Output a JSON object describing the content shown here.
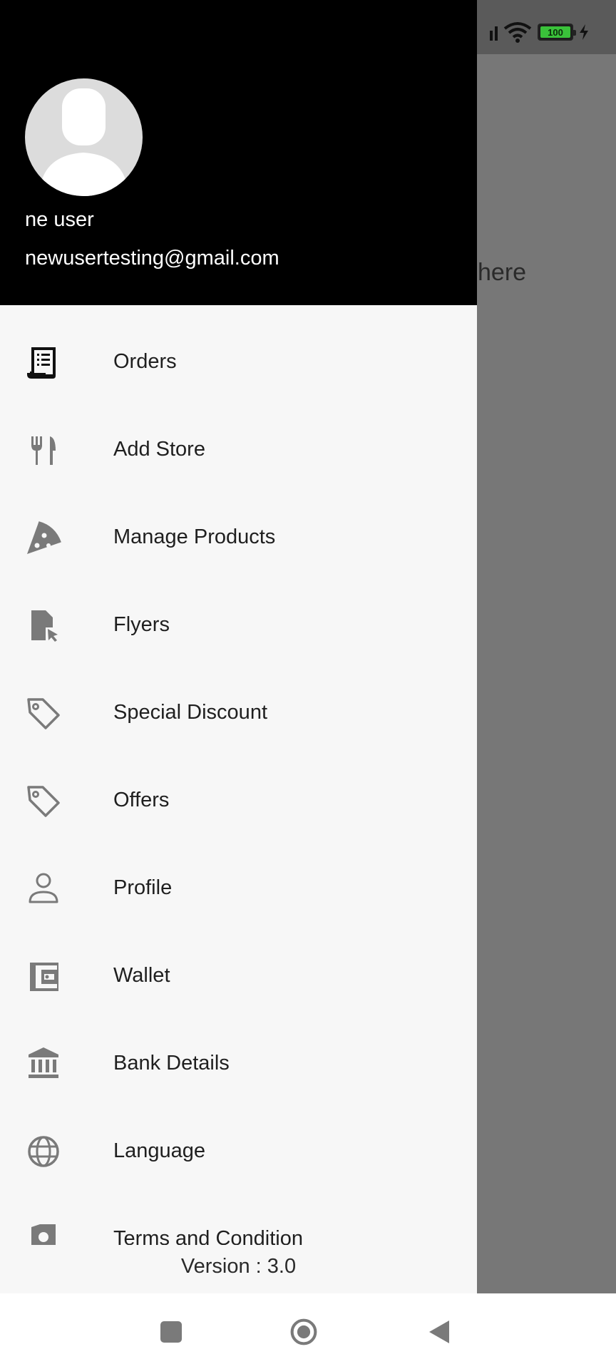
{
  "status_bar": {
    "battery_level": "100"
  },
  "background": {
    "partial_text": "here"
  },
  "drawer": {
    "header": {
      "user_name": "ne user",
      "user_email": "newusertesting@gmail.com"
    },
    "menu_items": [
      {
        "label": "Orders",
        "icon": "receipt-icon"
      },
      {
        "label": "Add Store",
        "icon": "restaurant-icon"
      },
      {
        "label": "Manage Products",
        "icon": "pizza-icon"
      },
      {
        "label": "Flyers",
        "icon": "file-pointer-icon"
      },
      {
        "label": "Special Discount",
        "icon": "tag-icon"
      },
      {
        "label": "Offers",
        "icon": "tag-icon"
      },
      {
        "label": "Profile",
        "icon": "person-icon"
      },
      {
        "label": "Wallet",
        "icon": "wallet-icon"
      },
      {
        "label": "Bank Details",
        "icon": "bank-icon"
      },
      {
        "label": "Language",
        "icon": "globe-icon"
      },
      {
        "label": "Terms and Condition",
        "icon": "document-icon"
      }
    ],
    "version": "Version : 3.0"
  },
  "colors": {
    "header_bg": "#000000",
    "drawer_bg": "#f7f7f7",
    "scrim": "#777777",
    "icon_gray": "#7a7a7a",
    "icon_dark": "#111111",
    "battery_green": "#3ac23a"
  },
  "nav_bar": {
    "buttons": [
      "recents-icon",
      "home-icon",
      "back-icon"
    ]
  }
}
